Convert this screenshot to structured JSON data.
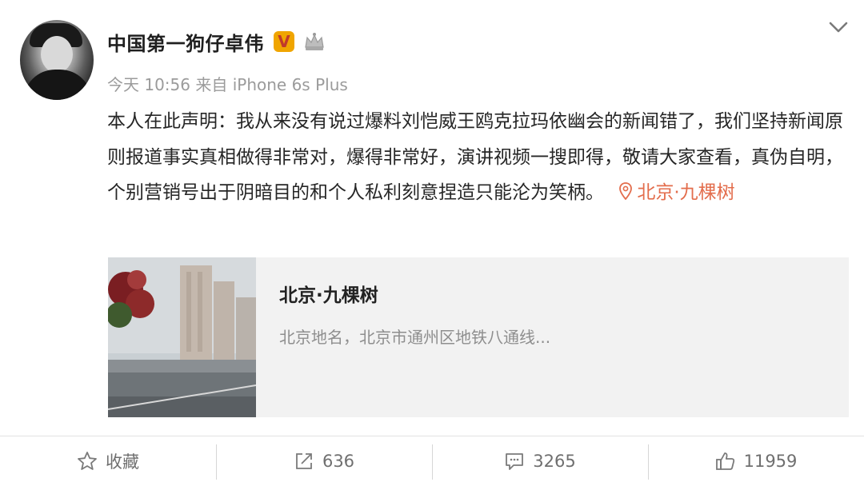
{
  "post": {
    "username": "中国第一狗仔卓伟",
    "verified_badge": "V",
    "meta": "今天 10:56 来自 iPhone 6s Plus",
    "body_text": "本人在此声明：我从来没有说过爆料刘恺威王鸥克拉玛依幽会的新闻错了，我们坚持新闻原则报道事实真相做得非常对，爆得非常好，演讲视频一搜即得，敬请大家查看，真伪自明，个别营销号出于阴暗目的和个人私利刻意捏造只能沦为笑柄。",
    "location": "北京·九棵树"
  },
  "card": {
    "title": "北京·九棵树",
    "description": "北京地名，北京市通州区地铁八通线..."
  },
  "actions": {
    "favorite_label": "收藏",
    "repost_count": "636",
    "comment_count": "3265",
    "like_count": "11959"
  },
  "colors": {
    "location_accent": "#e36d4c",
    "verified_bg": "#f0a500",
    "muted_text": "#9b9b9b"
  },
  "icons": [
    "crown-icon",
    "chevron-down-icon",
    "location-pin-icon",
    "star-icon",
    "repost-icon",
    "comment-icon",
    "thumbs-up-icon"
  ]
}
